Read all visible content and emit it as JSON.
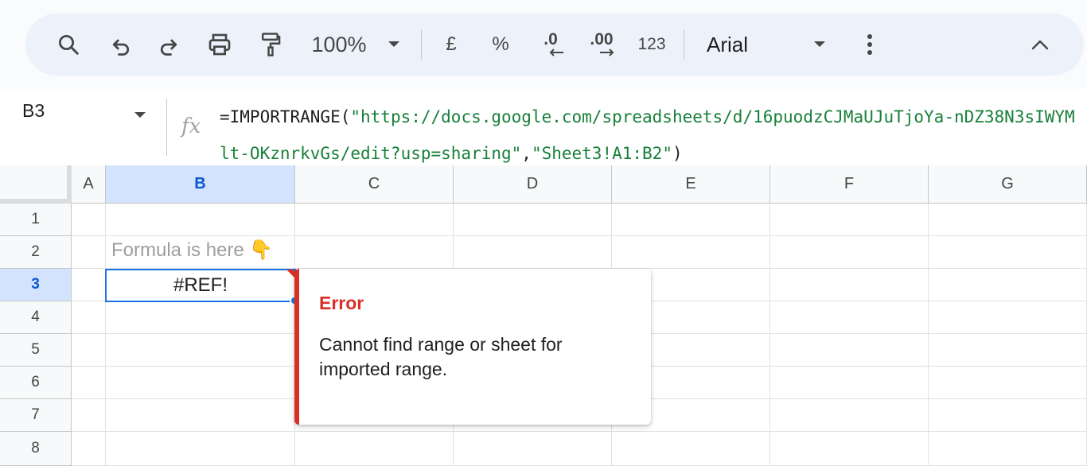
{
  "toolbar": {
    "zoom": "100%",
    "currency": "£",
    "percent": "%",
    "decrease_decimal": ".0",
    "increase_decimal": ".00",
    "number_format": "123",
    "font": "Arial",
    "icons": [
      "search-icon",
      "undo-icon",
      "redo-icon",
      "print-icon",
      "paint-format-icon",
      "chevron-down-icon",
      "more-vert-icon",
      "chevron-up-icon"
    ]
  },
  "formula_bar": {
    "cell_ref": "B3",
    "fx": "fx",
    "formula_prefix": "=IMPORTRANGE(",
    "arg1": "\"https://docs.google.com/spreadsheets/d/16puodzCJMaUJuTjoYa-nDZ38N3sIWYMlt-OKznrkvGs/edit?usp=sharing\"",
    "comma": ",",
    "arg2": "\"Sheet3!A1:B2\"",
    "formula_suffix": ")"
  },
  "grid": {
    "columns": [
      "A",
      "B",
      "C",
      "D",
      "E",
      "F",
      "G"
    ],
    "rows": [
      "1",
      "2",
      "3",
      "4",
      "5",
      "6",
      "7",
      "8"
    ],
    "selected_column": "B",
    "selected_row": "3",
    "cells": {
      "B2": "Formula is here 👇",
      "B3": "#REF!"
    }
  },
  "error_popup": {
    "title": "Error",
    "message": "Cannot find range or sheet for imported range."
  },
  "colors": {
    "accent": "#1a73e8",
    "error": "#d93025",
    "string": "#188038",
    "header_selected": "#d3e3fd"
  }
}
